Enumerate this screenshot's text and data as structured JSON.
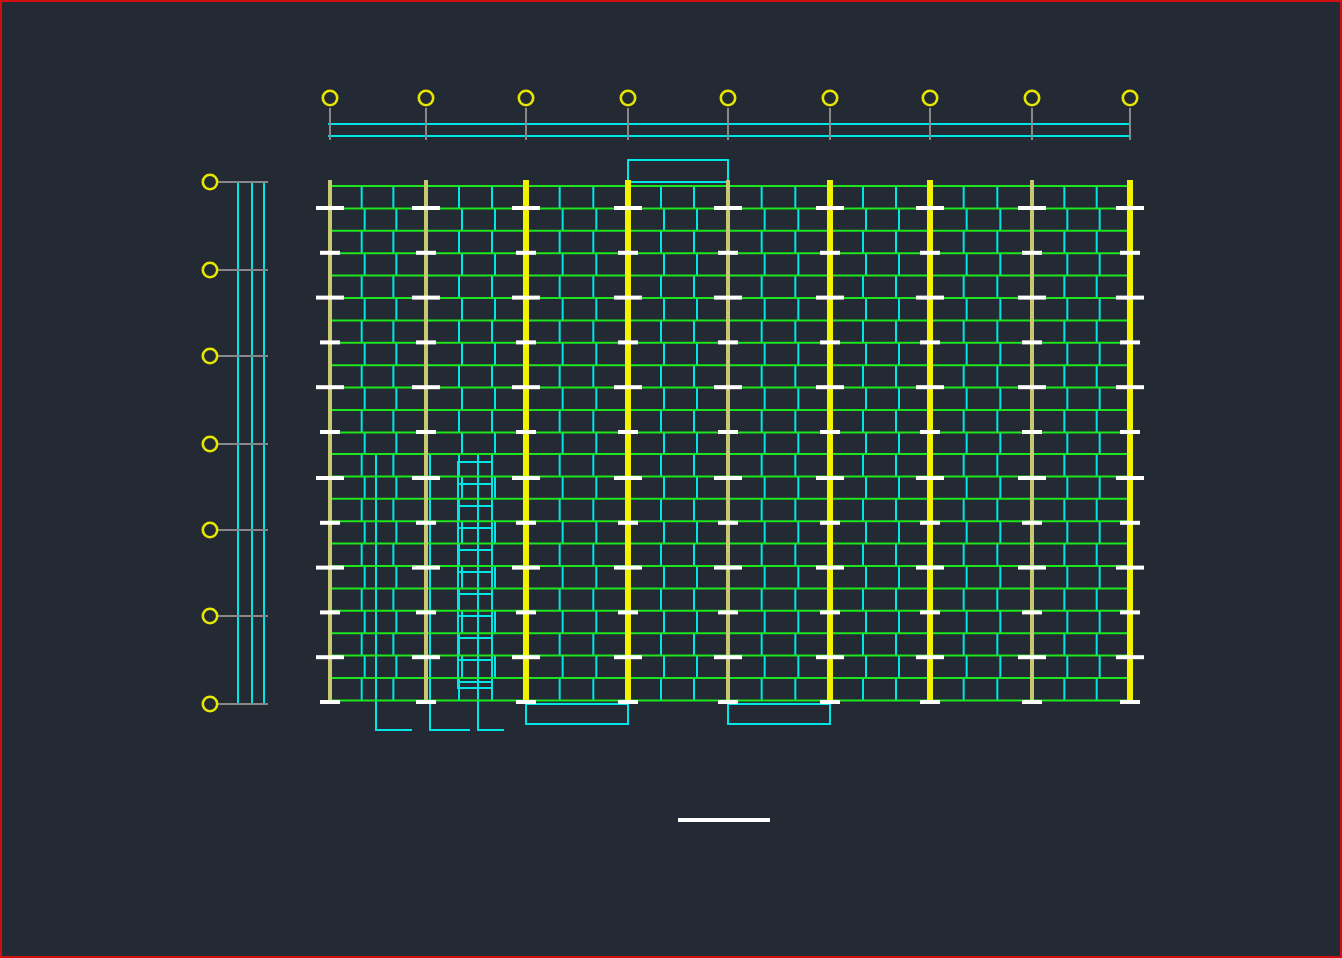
{
  "canvas": {
    "kind": "structural-plan"
  }
}
